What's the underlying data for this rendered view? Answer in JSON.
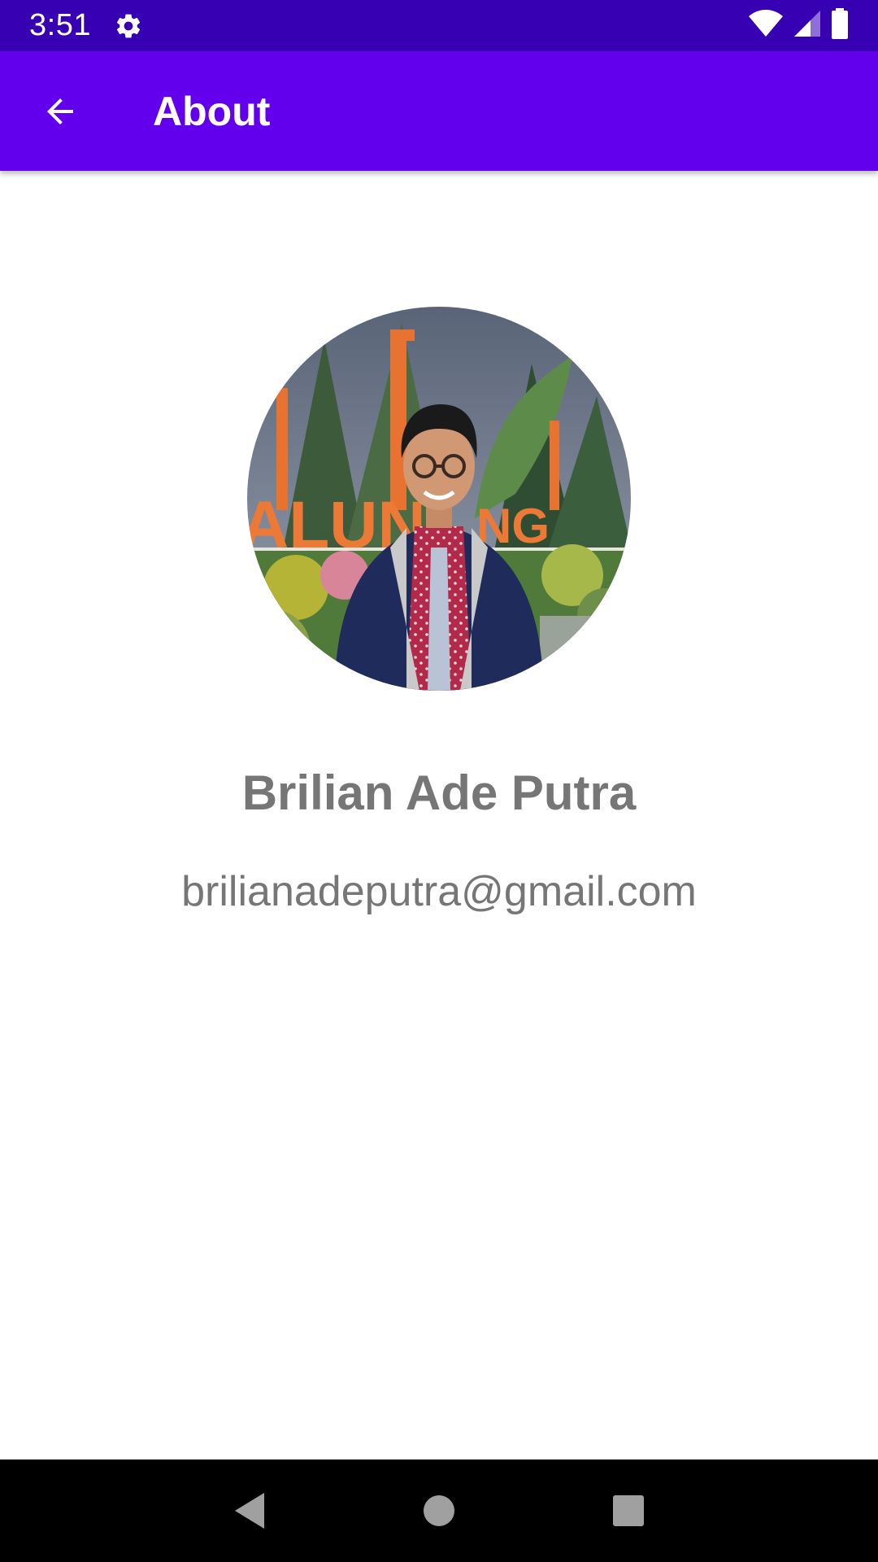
{
  "status_bar": {
    "time": "3:51",
    "icons": [
      "gear-icon",
      "wifi-icon",
      "cellular-signal-icon",
      "battery-icon"
    ]
  },
  "app_bar": {
    "title": "About",
    "back_icon": "arrow-back-icon"
  },
  "profile": {
    "photo_icon": "profile-photo",
    "name": "Brilian Ade Putra",
    "email": "brilianadeputra@gmail.com"
  },
  "nav_bar": {
    "icons": [
      "nav-back-icon",
      "nav-home-icon",
      "nav-recents-icon"
    ]
  },
  "colors": {
    "status_bar": "#3700b3",
    "app_bar": "#6200ee",
    "text_secondary": "#767676",
    "nav_bar": "#000000"
  }
}
